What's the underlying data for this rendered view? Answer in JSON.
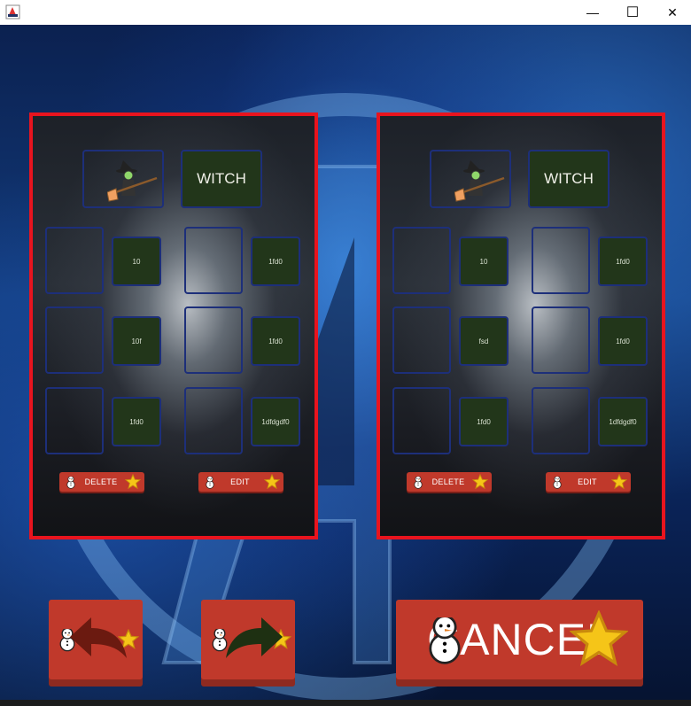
{
  "window": {
    "minimize_glyph": "—",
    "maximize_glyph": "☐",
    "close_glyph": "✕"
  },
  "cards": [
    {
      "character_name": "WITCH",
      "values": [
        "10",
        "1fd0",
        "10f",
        "1fd0",
        "1fd0",
        "1dfdgdf0"
      ],
      "delete_label": "DELETE",
      "edit_label": "EDIT"
    },
    {
      "character_name": "WITCH",
      "values": [
        "10",
        "1fd0",
        "fsd",
        "1fd0",
        "1fd0",
        "1dfdgdf0"
      ],
      "delete_label": "DELETE",
      "edit_label": "EDIT"
    }
  ],
  "footer": {
    "cancel_label": "CANCEL",
    "back_icon": "back-arrow-icon",
    "next_icon": "next-arrow-icon"
  },
  "colors": {
    "card_border": "#e8141e",
    "button_red": "#c0392b",
    "cell_fill": "#22361a",
    "cell_border": "#1d2f7a"
  }
}
